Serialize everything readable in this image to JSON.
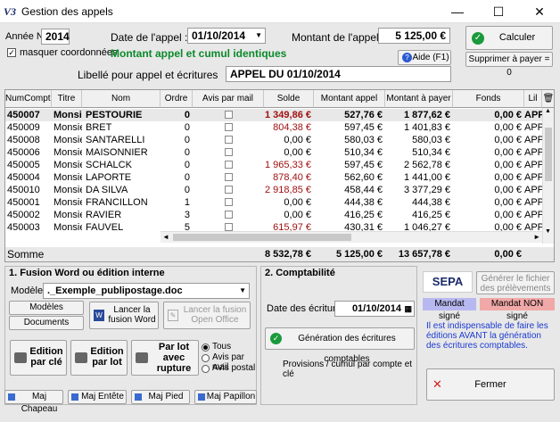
{
  "window": {
    "title": "Gestion des appels",
    "logo": "V3",
    "minimize": "—",
    "maximize": "☐",
    "close": "✕"
  },
  "header": {
    "annee_label": "Année N",
    "annee_value": "2014",
    "masquer_label": "masquer coordonnées",
    "masquer_checked": true,
    "date_label": "Date de l'appel :",
    "date_value": "01/10/2014",
    "montant_label": "Montant de l'appel",
    "montant_value": "5 125,00 €",
    "status_text": "Montant appel et cumul identiques",
    "libelle_label": "Libellé pour appel et écritures",
    "libelle_value": "APPEL DU 01/10/2014",
    "calculer": "Calculer",
    "aide": "Aide (F1)",
    "supprimer": "Supprimer à payer = 0"
  },
  "table": {
    "columns": [
      "NumCompte",
      "Titre",
      "Nom",
      "Ordre",
      "Avis par mail",
      "Solde",
      "Montant appel",
      "Montant à payer",
      "Fonds",
      "Lil"
    ],
    "rows": [
      {
        "num": "450007",
        "titre": "Monsi",
        "nom": "PESTOURIE",
        "ordre": "0",
        "solde": "1 349,86 €",
        "montant": "527,76 €",
        "apayer": "1 877,62 €",
        "fonds": "0,00 €",
        "lil": "APP",
        "solde_red": true,
        "selected": true
      },
      {
        "num": "450009",
        "titre": "Monsie",
        "nom": "BRET",
        "ordre": "0",
        "solde": "804,38 €",
        "montant": "597,45 €",
        "apayer": "1 401,83 €",
        "fonds": "0,00 €",
        "lil": "APP",
        "solde_red": true
      },
      {
        "num": "450008",
        "titre": "Monsie",
        "nom": "SANTARELLI",
        "ordre": "0",
        "solde": "0,00 €",
        "montant": "580,03 €",
        "apayer": "580,03 €",
        "fonds": "0,00 €",
        "lil": "APP",
        "solde_red": false
      },
      {
        "num": "450006",
        "titre": "Monsie",
        "nom": "MAISONNIER",
        "ordre": "0",
        "solde": "0,00 €",
        "montant": "510,34 €",
        "apayer": "510,34 €",
        "fonds": "0,00 €",
        "lil": "APP",
        "solde_red": false
      },
      {
        "num": "450005",
        "titre": "Monsie",
        "nom": "SCHALCK",
        "ordre": "0",
        "solde": "1 965,33 €",
        "montant": "597,45 €",
        "apayer": "2 562,78 €",
        "fonds": "0,00 €",
        "lil": "APP",
        "solde_red": true
      },
      {
        "num": "450004",
        "titre": "Monsie",
        "nom": "LAPORTE",
        "ordre": "0",
        "solde": "878,40 €",
        "montant": "562,60 €",
        "apayer": "1 441,00 €",
        "fonds": "0,00 €",
        "lil": "APP",
        "solde_red": true
      },
      {
        "num": "450010",
        "titre": "Monsie",
        "nom": "DA SILVA",
        "ordre": "0",
        "solde": "2 918,85 €",
        "montant": "458,44 €",
        "apayer": "3 377,29 €",
        "fonds": "0,00 €",
        "lil": "APP",
        "solde_red": true
      },
      {
        "num": "450001",
        "titre": "Monsie",
        "nom": "FRANCILLON",
        "ordre": "1",
        "solde": "0,00 €",
        "montant": "444,38 €",
        "apayer": "444,38 €",
        "fonds": "0,00 €",
        "lil": "APP",
        "solde_red": false
      },
      {
        "num": "450002",
        "titre": "Monsie",
        "nom": "RAVIER",
        "ordre": "3",
        "solde": "0,00 €",
        "montant": "416,25 €",
        "apayer": "416,25 €",
        "fonds": "0,00 €",
        "lil": "APP",
        "solde_red": false
      },
      {
        "num": "450003",
        "titre": "Monsie",
        "nom": "FAUVEL",
        "ordre": "5",
        "solde": "615,97 €",
        "montant": "430,31 €",
        "apayer": "1 046,27 €",
        "fonds": "0,00 €",
        "lil": "APP",
        "solde_red": true
      }
    ],
    "total_label": "Somme",
    "total_solde": "8 532,78 €",
    "total_montant": "5 125,00 €",
    "total_apayer": "13 657,78 €",
    "total_fonds": "0,00 €"
  },
  "fusion": {
    "title": "1. Fusion Word ou édition interne",
    "modele_label": "Modèle",
    "modele_value": "._Exemple_publipostage.doc",
    "modeles": "Modèles",
    "documents": "Documents",
    "lancer_word": "Lancer la fusion Word",
    "lancer_oo": "Lancer la fusion Open Office",
    "edition_cle": "Edition par clé",
    "edition_lot": "Edition par lot",
    "par_lot_rupture": "Par lot avec rupture",
    "radio_tous": "Tous",
    "radio_mail": "Avis par mail",
    "radio_postal": "Avis postal"
  },
  "compta": {
    "title": "2. Comptabilité",
    "date_label": "Date des écritures",
    "date_value": "01/10/2014",
    "generation": "Génération des écritures comptables",
    "provisions": "Provisions / cumul par compte et clé"
  },
  "sepa": {
    "logo": "SEPA",
    "generer": "Générer le fichier des prélèvements",
    "mandat_signe": "Mandat signé",
    "mandat_non": "Mandat NON signé",
    "info": "Il est indispensable de faire les éditions AVANT la génération des écritures comptables.",
    "fermer": "Fermer"
  },
  "footer": {
    "maj_chapeau": "Maj Chapeau",
    "maj_entete": "Maj Entête",
    "maj_pied": "Maj Pied",
    "maj_papillon": "Maj Papillon"
  },
  "colors": {
    "green": "#0a8a2a",
    "red": "#a01010",
    "mandat_signe": "#b8b8f0",
    "mandat_non": "#f0a8a8",
    "info_blue": "#1a3ad0"
  }
}
